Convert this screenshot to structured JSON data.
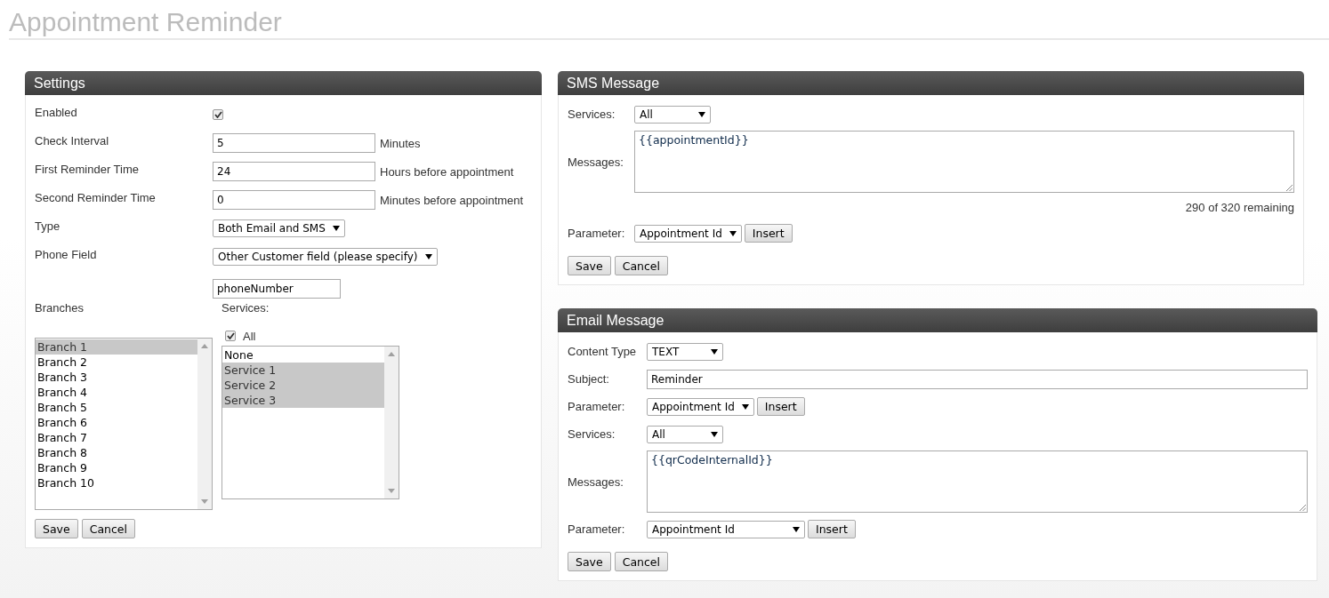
{
  "title": "Appointment Reminder",
  "settings": {
    "title": "Settings",
    "rows": [
      {
        "kind": "checkbox",
        "label": "Enabled",
        "checked": true
      },
      {
        "kind": "text",
        "label": "Check Interval",
        "value": "5",
        "unit": "Minutes"
      },
      {
        "kind": "text",
        "label": "First Reminder Time",
        "value": "24",
        "unit": "Hours before appointment"
      },
      {
        "kind": "text",
        "label": "Second Reminder Time",
        "value": "0",
        "unit": "Minutes before appointment"
      },
      {
        "kind": "select",
        "label": "Type",
        "value": "Both Email and SMS"
      },
      {
        "kind": "select",
        "label": "Phone Field",
        "value": "Other Customer field (please specify)"
      },
      {
        "kind": "text",
        "value": "phoneNumber"
      }
    ],
    "branches": {
      "label": "Branches",
      "items": [
        {
          "label": "Branch 1",
          "selected": true
        },
        {
          "label": "Branch 2",
          "selected": false
        },
        {
          "label": "Branch 3",
          "selected": false
        },
        {
          "label": "Branch 4",
          "selected": false
        },
        {
          "label": "Branch 5",
          "selected": false
        },
        {
          "label": "Branch 6",
          "selected": false
        },
        {
          "label": "Branch 7",
          "selected": false
        },
        {
          "label": "Branch 8",
          "selected": false
        },
        {
          "label": "Branch 9",
          "selected": false
        },
        {
          "label": "Branch 10",
          "selected": false
        }
      ]
    },
    "services": {
      "label": "Services:",
      "all": {
        "label": "All",
        "checked": true
      },
      "items": [
        {
          "label": "None",
          "selected": false
        },
        {
          "label": "Service 1",
          "selected": true
        },
        {
          "label": "Service 2",
          "selected": true
        },
        {
          "label": "Service 3",
          "selected": true
        }
      ]
    },
    "buttons": [
      "Save",
      "Cancel"
    ]
  },
  "sms": {
    "title": "SMS Message",
    "rows": [
      {
        "kind": "select",
        "label": "Services:",
        "value": "All"
      },
      {
        "kind": "textarea",
        "label": "Messages:",
        "value": "{{appointmentId}}"
      },
      {
        "kind": "note",
        "text": "290 of 320 remaining"
      },
      {
        "kind": "param",
        "label": "Parameter:",
        "value": "Appointment Id",
        "button": "Insert"
      }
    ],
    "buttons": [
      "Save",
      "Cancel"
    ]
  },
  "email": {
    "title": "Email Message",
    "rows": [
      {
        "kind": "select",
        "label": "Content Type",
        "value": "TEXT"
      },
      {
        "kind": "text",
        "label": "Subject:",
        "value": "Reminder"
      },
      {
        "kind": "param",
        "label": "Parameter:",
        "value": "Appointment Id",
        "button": "Insert"
      },
      {
        "kind": "select",
        "label": "Services:",
        "value": "All"
      },
      {
        "kind": "textarea",
        "label": "Messages:",
        "value": "{{qrCodeInternalId}}"
      },
      {
        "kind": "param",
        "label": "Parameter:",
        "value": "Appointment Id",
        "button": "Insert",
        "wide": true
      }
    ],
    "buttons": [
      "Save",
      "Cancel"
    ]
  }
}
